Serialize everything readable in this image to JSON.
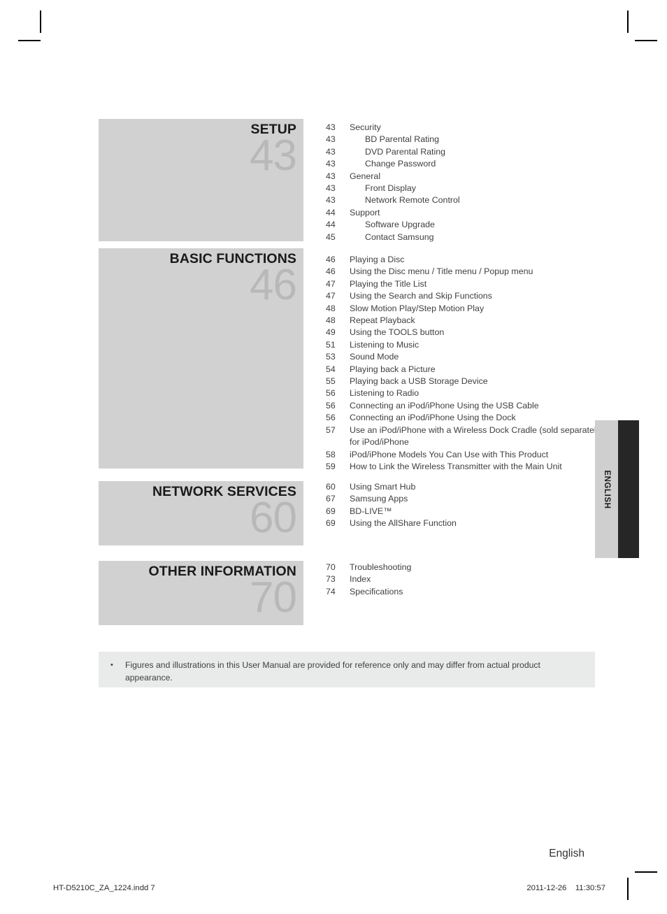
{
  "document": {
    "page_language": "English",
    "side_tab_label": "ENGLISH"
  },
  "sections": [
    {
      "title": "SETUP",
      "number": "43",
      "entries": [
        {
          "page": "43",
          "label": "Security",
          "indent": false
        },
        {
          "page": "43",
          "label": "BD Parental Rating",
          "indent": true
        },
        {
          "page": "43",
          "label": "DVD Parental Rating",
          "indent": true
        },
        {
          "page": "43",
          "label": "Change Password",
          "indent": true
        },
        {
          "page": "43",
          "label": "General",
          "indent": false
        },
        {
          "page": "43",
          "label": "Front Display",
          "indent": true
        },
        {
          "page": "43",
          "label": "Network Remote Control",
          "indent": true
        },
        {
          "page": "44",
          "label": "Support",
          "indent": false
        },
        {
          "page": "44",
          "label": "Software Upgrade",
          "indent": true
        },
        {
          "page": "45",
          "label": "Contact Samsung",
          "indent": true
        }
      ]
    },
    {
      "title": "BASIC FUNCTIONS",
      "number": "46",
      "entries": [
        {
          "page": "46",
          "label": "Playing a Disc",
          "indent": false
        },
        {
          "page": "46",
          "label": "Using the Disc menu / Title menu / Popup menu",
          "indent": false
        },
        {
          "page": "47",
          "label": "Playing the Title List",
          "indent": false
        },
        {
          "page": "47",
          "label": "Using the Search and Skip Functions",
          "indent": false
        },
        {
          "page": "48",
          "label": "Slow Motion Play/Step Motion Play",
          "indent": false
        },
        {
          "page": "48",
          "label": "Repeat Playback",
          "indent": false
        },
        {
          "page": "49",
          "label": "Using the TOOLS button",
          "indent": false
        },
        {
          "page": "51",
          "label": "Listening to Music",
          "indent": false
        },
        {
          "page": "53",
          "label": "Sound Mode",
          "indent": false
        },
        {
          "page": "54",
          "label": "Playing back a Picture",
          "indent": false
        },
        {
          "page": "55",
          "label": "Playing back a USB Storage Device",
          "indent": false
        },
        {
          "page": "56",
          "label": "Listening to Radio",
          "indent": false
        },
        {
          "page": "56",
          "label": "Connecting an iPod/iPhone Using the USB Cable",
          "indent": false
        },
        {
          "page": "56",
          "label": "Connecting an iPod/iPhone Using the Dock",
          "indent": false
        },
        {
          "page": "57",
          "label": "Use an iPod/iPhone with a Wireless Dock Cradle (sold separately) for iPod/iPhone",
          "indent": false,
          "wrap": true
        },
        {
          "page": "58",
          "label": "iPod/iPhone Models You Can Use with This Product",
          "indent": false
        },
        {
          "page": "59",
          "label": "How to Link the Wireless Transmitter with the Main Unit",
          "indent": false
        }
      ]
    },
    {
      "title": "NETWORK SERVICES",
      "number": "60",
      "entries": [
        {
          "page": "60",
          "label": "Using Smart Hub",
          "indent": false
        },
        {
          "page": "67",
          "label": "Samsung Apps",
          "indent": false
        },
        {
          "page": "69",
          "label": "BD-LIVE™",
          "indent": false
        },
        {
          "page": "69",
          "label": "Using the AllShare Function",
          "indent": false
        }
      ]
    },
    {
      "title": "OTHER INFORMATION",
      "number": "70",
      "entries": [
        {
          "page": "70",
          "label": "Troubleshooting",
          "indent": false
        },
        {
          "page": "73",
          "label": "Index",
          "indent": false
        },
        {
          "page": "74",
          "label": "Specifications",
          "indent": false
        }
      ]
    }
  ],
  "note": {
    "bullet": "•",
    "text": "Figures and illustrations in this User Manual are provided for reference only and may differ from actual product appearance."
  },
  "footer": {
    "language": "English",
    "file": "HT-D5210C_ZA_1224.indd   7",
    "date": "2011-12-26",
    "time": "11:30:57"
  },
  "colors": {
    "section_box": "#d1d1d1",
    "section_number": "#b8b8b8",
    "note_box": "#e9eaea",
    "lang_tab": "#cfcfcf",
    "lang_bar": "#262626"
  }
}
